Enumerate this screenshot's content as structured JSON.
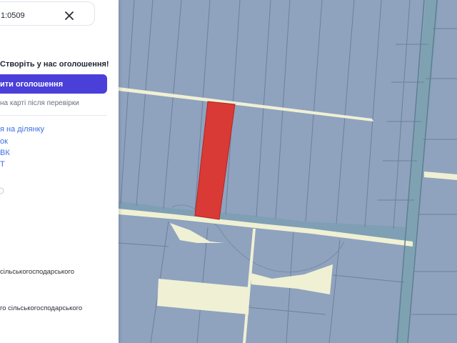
{
  "search": {
    "value": "1:0509"
  },
  "promo": {
    "title": "Створіть у нас оголошення!"
  },
  "cta": {
    "label": "ити оголошення"
  },
  "hint": {
    "text": "на карті після перевірки"
  },
  "links": [
    {
      "label": "я на ділянку"
    },
    {
      "label": "ок"
    },
    {
      "label": "ВК"
    },
    {
      "label": "Т"
    }
  ],
  "purposes": [
    {
      "text": "сільськогосподарського"
    },
    {
      "text": "го сільськогосподарського"
    }
  ],
  "icons": {
    "close": "close-icon",
    "info": "info-icon"
  },
  "colors": {
    "selected_parcel": "#d93a35",
    "parcel_fill": "#8fa3bf",
    "road_fill": "#f0f0d4",
    "cta_button": "#4a3fd8",
    "link": "#3d6fe0"
  }
}
